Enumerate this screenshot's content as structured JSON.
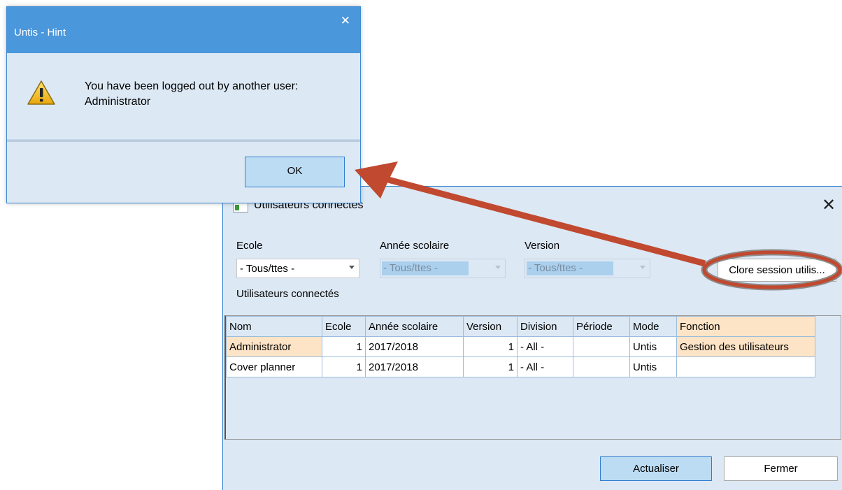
{
  "hint_dialog": {
    "title": "Untis - Hint",
    "close_glyph": "✕",
    "icon": "warning-icon",
    "message_line1": "You have been logged out by another user:",
    "message_line2": "Administrator",
    "ok_label": "OK"
  },
  "users_window": {
    "title": "Utilisateurs connectés",
    "close_glyph": "✕",
    "ecole_label": "Ecole",
    "ecole_value": "- Tous/ttes -",
    "annee_label": "Année scolaire",
    "annee_value": "- Tous/ttes -",
    "version_label": "Version",
    "version_value": "- Tous/ttes -",
    "clore_label": "Clore session utilis...",
    "section_label": "Utilisateurs connectés",
    "table": {
      "headers": [
        "Nom",
        "Ecole",
        "Année scolaire",
        "Version",
        "Division",
        "Période",
        "Mode",
        "Fonction"
      ],
      "rows": [
        [
          "Administrator",
          "1",
          "2017/2018",
          "1",
          "- All -",
          "",
          "Untis",
          "Gestion des utilisateurs"
        ],
        [
          "Cover planner",
          "1",
          "2017/2018",
          "1",
          "- All -",
          "",
          "Untis",
          ""
        ]
      ]
    },
    "actualiser_label": "Actualiser",
    "fermer_label": "Fermer"
  },
  "annotation": {
    "arrow_color": "#c0492f",
    "highlight_color": "#c0492f"
  }
}
